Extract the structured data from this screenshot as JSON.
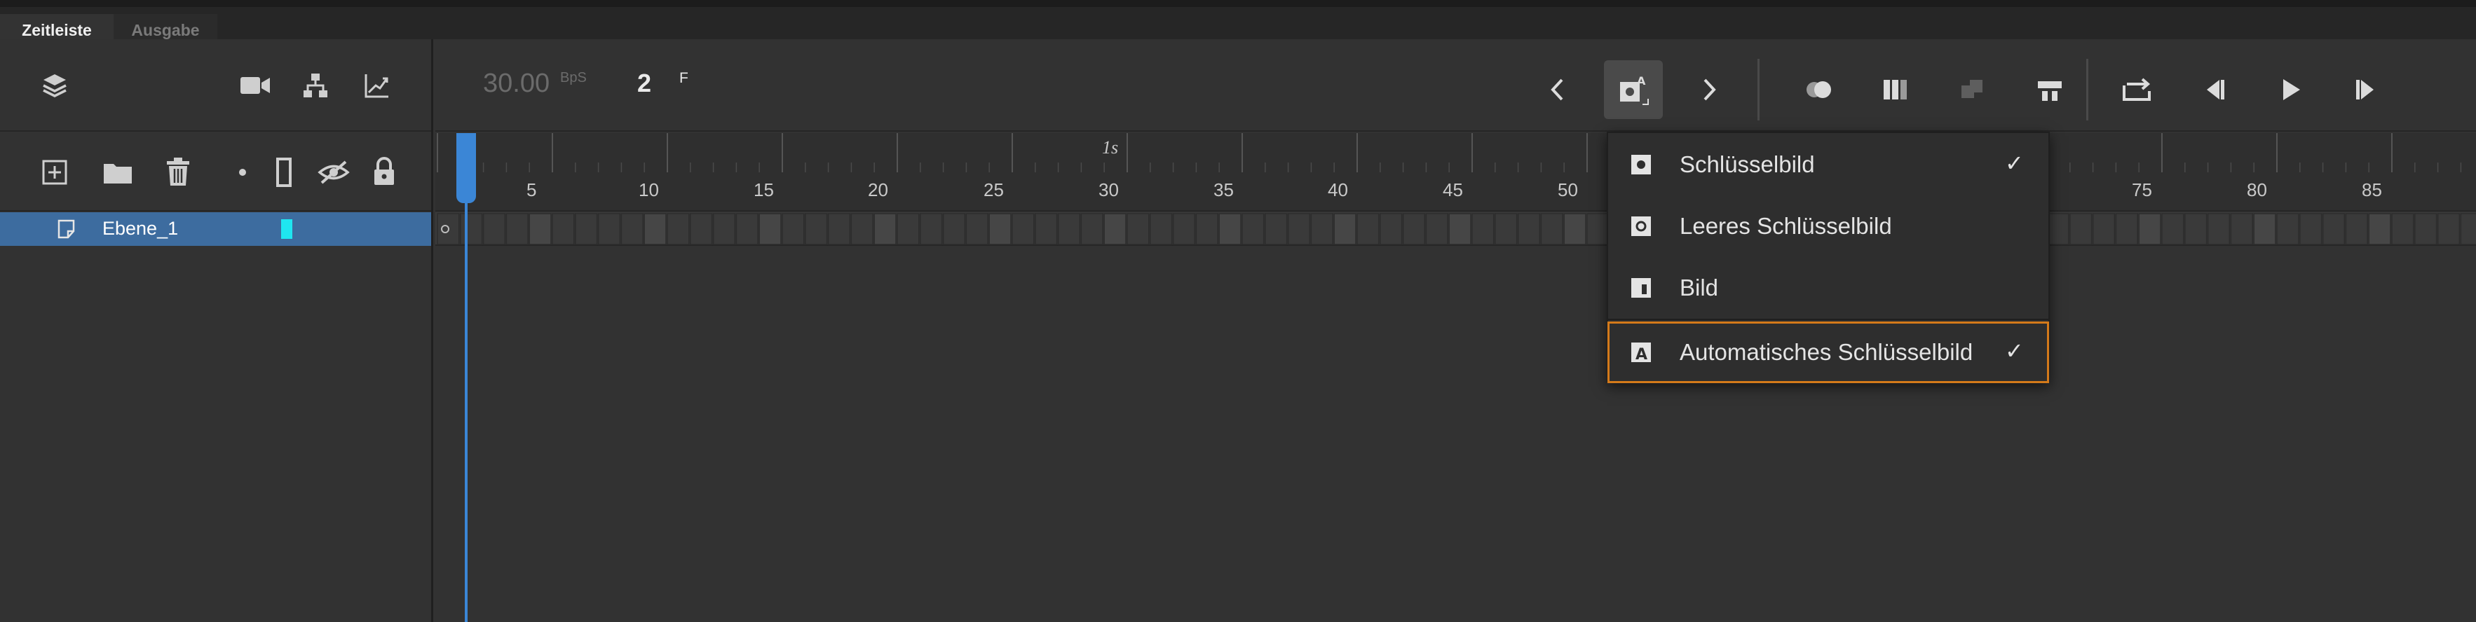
{
  "tabs": [
    {
      "label": "Zeitleiste",
      "active": true
    },
    {
      "label": "Ausgabe",
      "active": false
    }
  ],
  "layers_panel": {
    "toolbar_top_icons": [
      "layers-icon",
      "camera-icon",
      "hierarchy-icon",
      "graph-icon"
    ],
    "toolbar_bottom_icons": [
      "new-layer-icon",
      "folder-icon",
      "trash-icon",
      "dot-icon",
      "outline-icon",
      "visibility-icon",
      "lock-icon"
    ],
    "layers": [
      {
        "name": "Ebene_1",
        "color": "#1fe6f0",
        "selected": true
      }
    ]
  },
  "timeline": {
    "fps_value": "30.00",
    "fps_unit": "BpS",
    "current_frame": "2",
    "frame_unit": "F",
    "second_marker": "1s",
    "ruler_numbers": [
      "5",
      "10",
      "15",
      "20",
      "25",
      "30",
      "35",
      "40",
      "45",
      "50",
      "75",
      "80",
      "85"
    ],
    "playhead_frame": 2,
    "accent": "#3b86d6"
  },
  "menu": {
    "items": [
      {
        "label": "Schlüsselbild",
        "icon": "keyframe-icon",
        "checked": true
      },
      {
        "label": "Leeres Schlüsselbild",
        "icon": "blank-keyframe-icon",
        "checked": false
      },
      {
        "label": "Bild",
        "icon": "frame-icon",
        "checked": false
      },
      {
        "label": "Automatisches Schlüsselbild",
        "icon": "auto-keyframe-icon",
        "checked": true
      }
    ],
    "check_glyph": "✓",
    "highlight_color": "#d47a1a"
  }
}
